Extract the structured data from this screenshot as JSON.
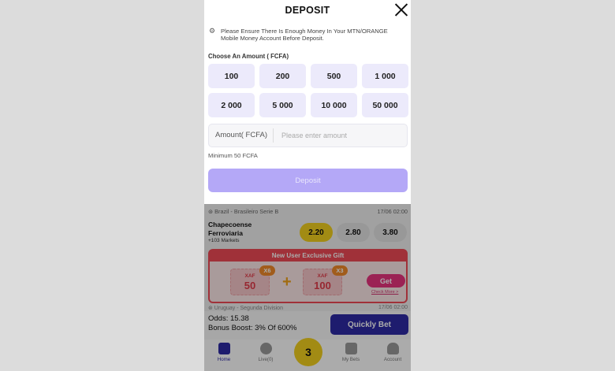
{
  "modal": {
    "title": "DEPOSIT",
    "notice": "Please Ensure There Is Enough Money In Your MTN/ORANGE Mobile Money Account Before Deposit.",
    "choose_label": "Choose An Amount ( FCFA)",
    "amounts": [
      "100",
      "200",
      "500",
      "1 000",
      "2 000",
      "5 000",
      "10 000",
      "50 000"
    ],
    "input_label": "Amount( FCFA)",
    "input_placeholder": "Please enter amount",
    "minimum": "Minimum 50 FCFA",
    "deposit_button": "Deposit"
  },
  "match": {
    "league": "⊛ Brazil - Brasileiro Serie B",
    "time": "17/06 02:00",
    "team1": "Chapecoense",
    "team2": "Ferroviaria",
    "markets": "+103 Markets",
    "odds": [
      "2.20",
      "2.80",
      "3.80"
    ],
    "selected_odd_index": 0
  },
  "gift": {
    "title": "New User Exclusive Gift",
    "tickets": [
      {
        "currency": "XAF",
        "value": "50",
        "multiplier": "X6"
      },
      {
        "currency": "XAF",
        "value": "100",
        "multiplier": "X3"
      }
    ],
    "plus": "+",
    "get_button": "Get",
    "check_more": "Check More >"
  },
  "next_match": {
    "league": "⊛ Uruguay - Segunda Division",
    "time": "17/06 02:00"
  },
  "betbar": {
    "odds": "Odds: 15.38",
    "bonus": "Bonus Boost: 3% Of 600%",
    "quick_bet": "Quickly Bet"
  },
  "nav": {
    "items": [
      "Home",
      "Live(0)",
      "My Bets",
      "Account"
    ],
    "betslip_count": "3"
  },
  "colors": {
    "accent": "#2e2aa4",
    "deposit_disabled": "#b4a8f7",
    "amount_tile": "#eceafb",
    "selected_odd": "#f2cf1e",
    "gift_red": "#ef4a55"
  }
}
